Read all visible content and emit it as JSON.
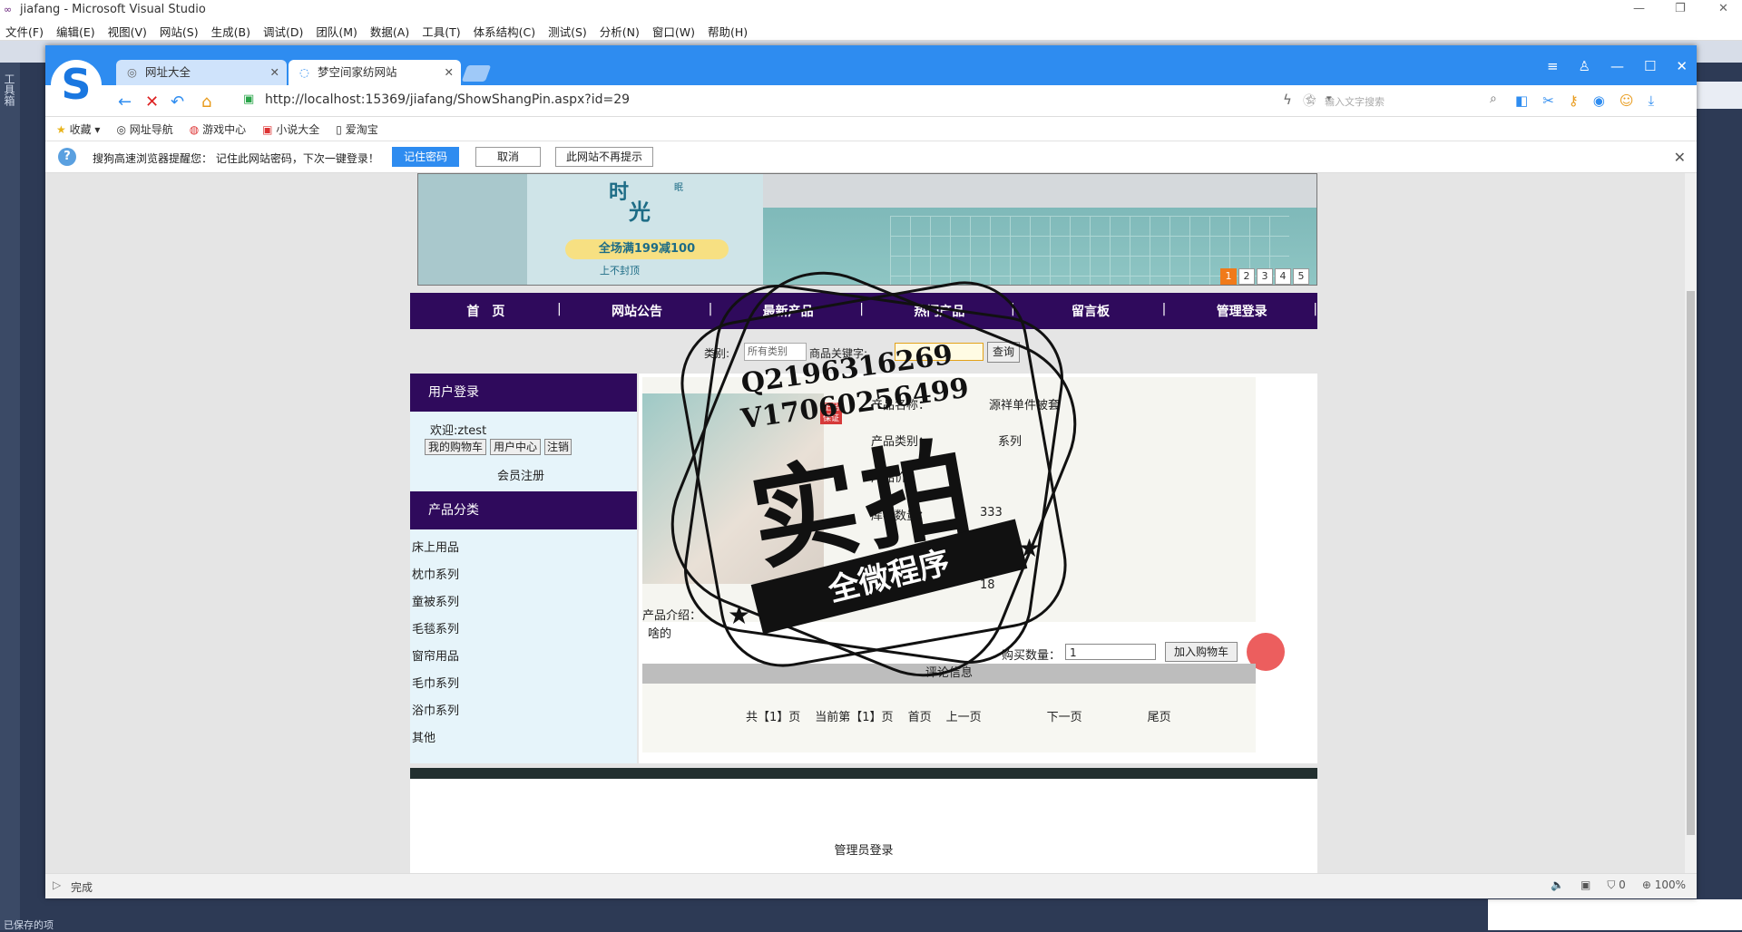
{
  "vs": {
    "title": "jiafang - Microsoft Visual Studio",
    "menu": [
      "文件(F)",
      "编辑(E)",
      "视图(V)",
      "网站(S)",
      "生成(B)",
      "调试(D)",
      "团队(M)",
      "数据(A)",
      "工具(T)",
      "体系结构(C)",
      "测试(S)",
      "分析(N)",
      "窗口(W)",
      "帮助(H)"
    ],
    "toolbox_label": "工具箱",
    "status": "已保存的项"
  },
  "browser": {
    "tabs": [
      {
        "label": "网址大全"
      },
      {
        "label": "梦空间家纺网站"
      }
    ],
    "url": "http://localhost:15369/jiafang/ShowShangPin.aspx?id=29",
    "search_placeholder": "输入文字搜索",
    "bookmarks": [
      "收藏",
      "网址导航",
      "游戏中心",
      "小说大全",
      "爱淘宝"
    ],
    "notify": {
      "text": "搜狗高速浏览器提醒您： 记住此网站密码，下次一键登录！",
      "save": "记住密码",
      "cancel": "取消",
      "never": "此网站不再提示"
    },
    "status_text": "完成",
    "status_count": "0",
    "zoom": "100%"
  },
  "page": {
    "banner": {
      "line1": "时",
      "line2": "光",
      "small": "眠",
      "promo": "全场满199减100",
      "sub": "上不封顶",
      "pages": [
        "1",
        "2",
        "3",
        "4",
        "5"
      ],
      "active_page": 1
    },
    "nav": [
      "首　页",
      "网站公告",
      "最新产品",
      "热门产品",
      "留言板",
      "管理登录"
    ],
    "search": {
      "category_label": "类别:",
      "category_value": "所有类别",
      "keyword_label": "商品关键字:",
      "button": "查询"
    },
    "login": {
      "header": "用户登录",
      "welcome": "欢迎:ztest",
      "cart": "我的购物车",
      "center": "用户中心",
      "logout": "注销",
      "register": "会员注册"
    },
    "categories": {
      "header": "产品分类",
      "items": [
        "床上用品",
        "枕巾系列",
        "童被系列",
        "毛毯系列",
        "窗帘用品",
        "毛巾系列",
        "浴巾系列",
        "其他"
      ]
    },
    "product": {
      "name_label": "产品名称：",
      "name_value": "源祥单件被套",
      "type_label": "产品类别：",
      "type_value": "系列",
      "price_label": "产品价：",
      "stock_label": "库存数量：",
      "stock_value": "333",
      "sold_value": "18",
      "intro_label": "产品介绍：",
      "intro_text": "啥的",
      "qty_label": "购买数量：",
      "qty_value": "1",
      "add_cart": "加入购物车",
      "img_tag": "正品保证"
    },
    "comments": {
      "header": "评论信息",
      "total": "共【1】页",
      "current": "当前第【1】页",
      "first": "首页",
      "prev": "上一页",
      "next": "下一页",
      "last": "尾页"
    },
    "footer_admin": "管理员登录"
  },
  "watermark": {
    "qq": "Q2196316269",
    "vx": "V17060256499",
    "big": "实拍",
    "banner": "全微程序"
  }
}
